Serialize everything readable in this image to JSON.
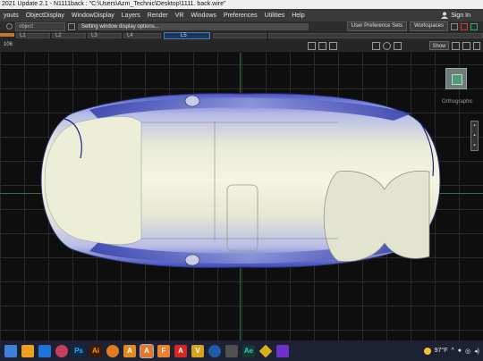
{
  "window": {
    "title": "2021 Update 2.1   - N1111back : \"C:\\Users\\Azm_Technic\\Desktop\\1111. back.wire\""
  },
  "menu": {
    "items": [
      "youts",
      "ObjectDisplay",
      "WindowDisplay",
      "Layers",
      "Render",
      "VR",
      "Windows",
      "Preferences",
      "Utilities",
      "Help"
    ],
    "sign_in": "Sign In"
  },
  "toolbar": {
    "field": "object",
    "status": "Setting window display options...",
    "user_pref": "User Preference Sets",
    "workspaces": "Workspaces"
  },
  "timeline": {
    "labels": [
      "L1",
      "L2",
      "L3",
      "L4",
      "L5"
    ]
  },
  "viewport": {
    "label": "106",
    "show_button": "Show",
    "ortho_label": "Orthographic",
    "colors": {
      "background": "#0e0e0e",
      "grid": "#2a2a2a",
      "axis": "#3f6a3f"
    }
  },
  "taskbar": {
    "icons": [
      {
        "name": "windows-start-icon",
        "glyph": "",
        "color": "#3c82d8"
      },
      {
        "name": "store-icon",
        "glyph": "",
        "color": "#f0a020"
      },
      {
        "name": "mail-icon",
        "glyph": "",
        "color": "#1e74d8"
      },
      {
        "name": "chrome-icon",
        "glyph": "",
        "color": "#c63d5e"
      },
      {
        "name": "photoshop-icon",
        "glyph": "Ps",
        "color": "#0c2a44"
      },
      {
        "name": "illustrator-icon",
        "glyph": "Ai",
        "color": "#3a1a06"
      },
      {
        "name": "blender-icon",
        "glyph": "",
        "color": "#e07b20"
      },
      {
        "name": "autodesk-alias-icon",
        "glyph": "A",
        "color": "#e08a1f"
      },
      {
        "name": "autodesk-alias-active-icon",
        "glyph": "A",
        "color": "#e07a2a"
      },
      {
        "name": "autodesk-fusion-icon",
        "glyph": "F",
        "color": "#f08030"
      },
      {
        "name": "autodesk-red-icon",
        "glyph": "A",
        "color": "#d8281e"
      },
      {
        "name": "vred-icon",
        "glyph": "V",
        "color": "#d8a21e"
      },
      {
        "name": "cinema4d-icon",
        "glyph": "",
        "color": "#1f5da8"
      },
      {
        "name": "keyshot-icon",
        "glyph": "",
        "color": "#505050"
      },
      {
        "name": "media-encoder-icon",
        "glyph": "Ae",
        "color": "#123a2a"
      },
      {
        "name": "app-icon-diamond",
        "glyph": "",
        "color": "#d8b01e"
      },
      {
        "name": "premiere-icon",
        "glyph": "",
        "color": "#7030d0"
      }
    ],
    "weather": "97°F"
  }
}
